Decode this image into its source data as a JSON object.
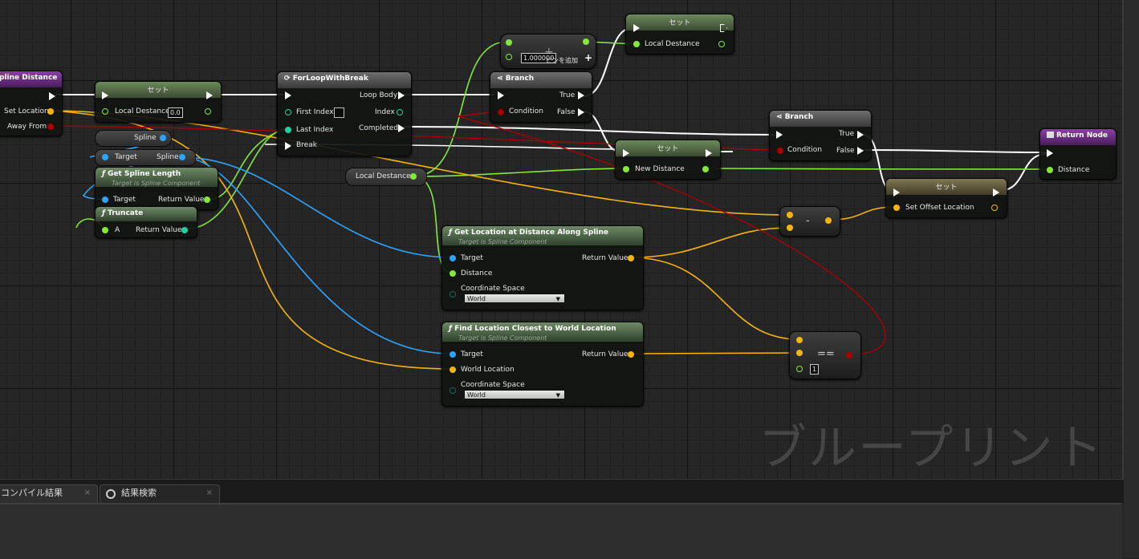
{
  "nodes": {
    "spline_distance": {
      "title": "pline Distance",
      "pins": {
        "set_location": "Set Location",
        "away_from": "Away From"
      }
    },
    "set1": {
      "title": "セット",
      "var": "Local Destance",
      "value": "0.0"
    },
    "spline_var": {
      "label": "Spline"
    },
    "target_spline": {
      "in": "Target",
      "out": "Spline"
    },
    "get_spline_length": {
      "title": "Get Spline Length",
      "subtitle": "Target is Spline Component",
      "in": "Target",
      "out": "Return Value"
    },
    "truncate": {
      "title": "Truncate",
      "in": "A",
      "out": "Return Value"
    },
    "for_loop": {
      "title": "ForLoopWithBreak",
      "first_index": "First Index",
      "last_index": "Last Index",
      "break": "Break",
      "loop_body": "Loop Body",
      "index": "Index",
      "completed": "Completed"
    },
    "add_node": {
      "value": "1.000000",
      "add_pin": "ピンを追加"
    },
    "set_top": {
      "title": "セット",
      "var": "Local Destance"
    },
    "branch1": {
      "title": "Branch",
      "condition": "Condition",
      "true": "True",
      "false": "False"
    },
    "local_destance_var": {
      "label": "Local Destance"
    },
    "set_new_distance": {
      "title": "セット",
      "var": "New Distance"
    },
    "branch2": {
      "title": "Branch",
      "condition": "Condition",
      "true": "True",
      "false": "False"
    },
    "return_node": {
      "title": "Return Node",
      "out": "Distance"
    },
    "set_offset": {
      "title": "セット",
      "var": "Set Offset Location"
    },
    "subtract": {
      "op": "-"
    },
    "get_location": {
      "title": "Get Location at Distance Along Spline",
      "subtitle": "Target is Spline Component",
      "target": "Target",
      "distance": "Distance",
      "coord": "Coordinate Space",
      "coord_value": "World",
      "out": "Return Value"
    },
    "find_location": {
      "title": "Find Location Closest to World Location",
      "subtitle": "Target is Spline Component",
      "target": "Target",
      "world_location": "World Location",
      "coord": "Coordinate Space",
      "coord_value": "World",
      "out": "Return Value"
    },
    "equals": {
      "op": "==",
      "value": "1"
    }
  },
  "watermark": "ブループリント",
  "tabs": [
    {
      "label": "コンパイル結果",
      "close": "×"
    },
    {
      "label": "結果検索",
      "close": "×"
    }
  ],
  "colors": {
    "exec": "#ffffff",
    "float": "#84e83b",
    "vector": "#f7b40c",
    "object": "#2ba6ff",
    "bool": "#a80000",
    "int": "#1fd3a1"
  }
}
